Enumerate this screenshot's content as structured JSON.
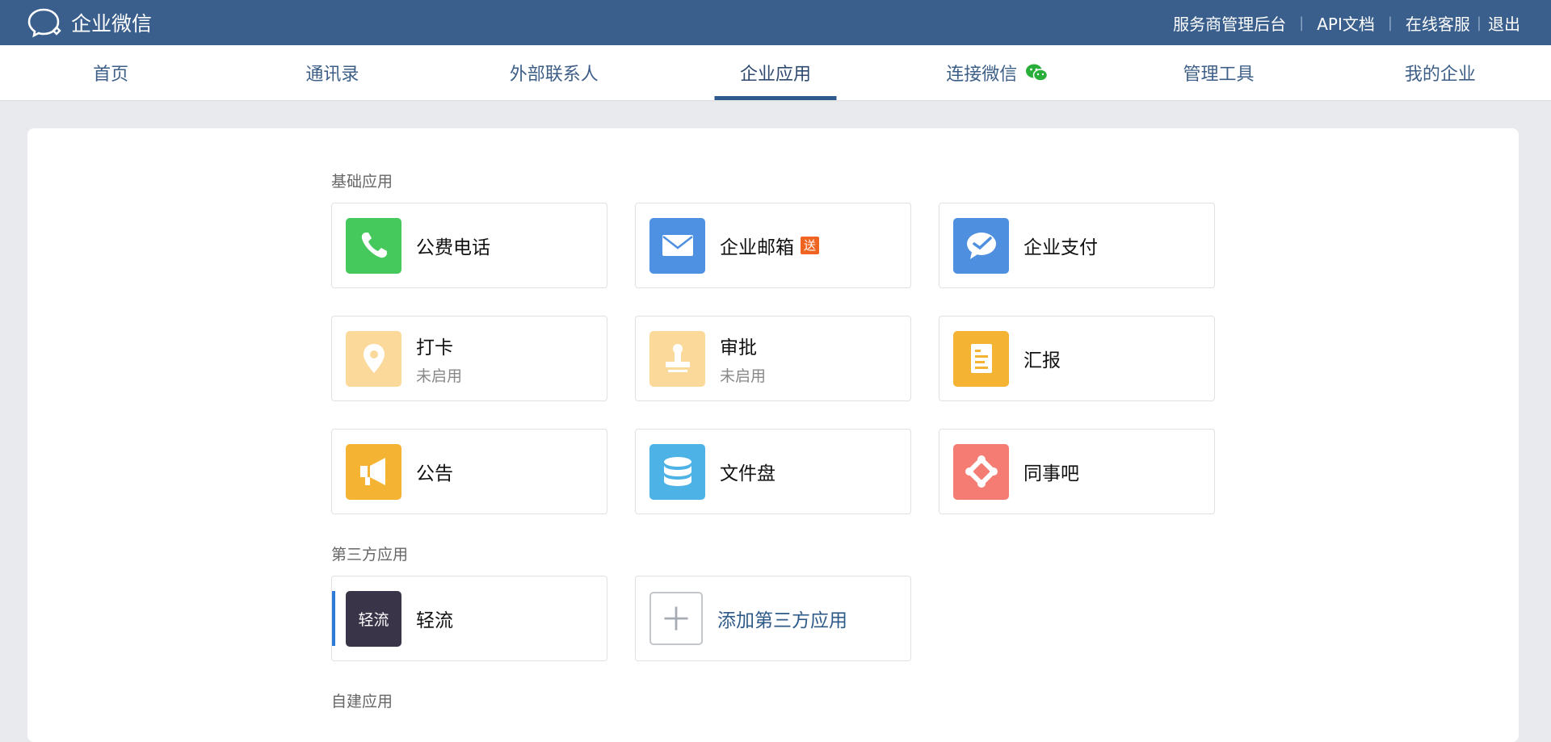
{
  "header": {
    "brand": "企业微信",
    "links": [
      "服务商管理后台",
      "API文档",
      "在线客服",
      "退出"
    ]
  },
  "nav": {
    "tabs": [
      "首页",
      "通讯录",
      "外部联系人",
      "企业应用",
      "连接微信",
      "管理工具",
      "我的企业"
    ],
    "active": "企业应用"
  },
  "sections": {
    "basic": "基础应用",
    "third": "第三方应用",
    "custom": "自建应用"
  },
  "apps": {
    "gongfei": {
      "name": "公费电话",
      "color": "#45c95c",
      "icon": "phone-icon"
    },
    "mail": {
      "name": "企业邮箱",
      "badge": "送",
      "color": "#4e90e2",
      "icon": "mail-icon"
    },
    "pay": {
      "name": "企业支付",
      "color": "#4e8fe0",
      "icon": "pay-icon"
    },
    "checkin": {
      "name": "打卡",
      "sub": "未启用",
      "color": "#fbd99a",
      "icon": "location-pin-icon"
    },
    "approval": {
      "name": "审批",
      "sub": "未启用",
      "color": "#fbd99a",
      "icon": "stamp-icon"
    },
    "report": {
      "name": "汇报",
      "color": "#f5b334",
      "icon": "report-icon"
    },
    "notice": {
      "name": "公告",
      "color": "#f5b334",
      "icon": "megaphone-icon"
    },
    "disk": {
      "name": "文件盘",
      "color": "#4db3e6",
      "icon": "database-icon"
    },
    "colleague": {
      "name": "同事吧",
      "color": "#f47c73",
      "icon": "network-icon"
    },
    "qingliu": {
      "name": "轻流",
      "logo_text": "轻流",
      "color": "#3a3448",
      "icon": "qingliu-logo"
    },
    "add_third": {
      "name": "添加第三方应用",
      "icon": "plus-icon"
    }
  }
}
